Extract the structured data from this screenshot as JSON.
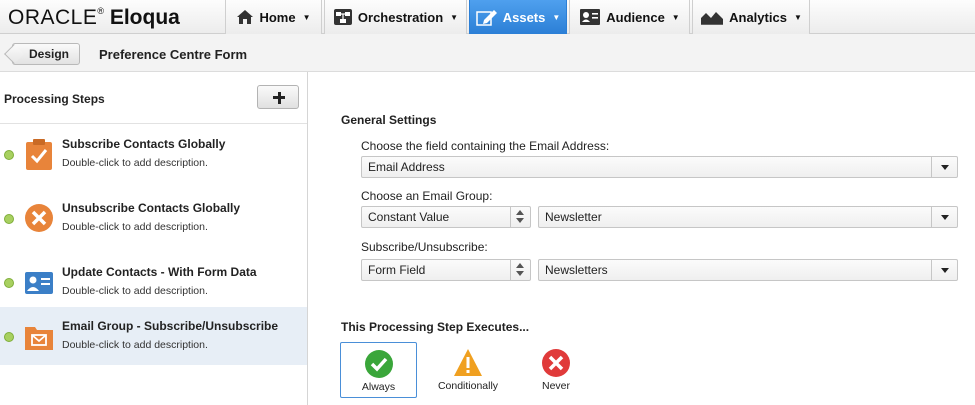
{
  "brand": {
    "oracle": "ORACLE",
    "product": "Eloqua"
  },
  "nav": {
    "items": [
      {
        "label": "Home",
        "icon": "house-icon"
      },
      {
        "label": "Orchestration",
        "icon": "orchestration-icon"
      },
      {
        "label": "Assets",
        "icon": "pencil-icon",
        "active": true
      },
      {
        "label": "Audience",
        "icon": "contact-card-icon"
      },
      {
        "label": "Analytics",
        "icon": "area-chart-icon"
      }
    ]
  },
  "breadcrumb": {
    "back_label": "Design",
    "title": "Preference Centre Form"
  },
  "steps_panel": {
    "title": "Processing Steps",
    "add_button": "+",
    "steps": [
      {
        "name": "Subscribe Contacts Globally",
        "description": "Double-click to add description.",
        "icon": "clipboard-check-icon",
        "color": "#e8843a"
      },
      {
        "name": "Unsubscribe Contacts Globally",
        "description": "Double-click to add description.",
        "icon": "circle-x-icon",
        "color": "#e8843a"
      },
      {
        "name": "Update Contacts - With Form Data",
        "description": "Double-click to add description.",
        "icon": "contact-card-icon",
        "color": "#3b7fc7"
      },
      {
        "name": "Email Group - Subscribe/Unsubscribe",
        "description": "Double-click to add description.",
        "icon": "email-folder-icon",
        "color": "#e8843a",
        "selected": true
      }
    ]
  },
  "general_settings": {
    "title": "General Settings",
    "email_field_label": "Choose the field containing the Email Address:",
    "email_field_value": "Email Address",
    "email_group_label": "Choose an Email Group:",
    "email_group_source": "Constant Value",
    "email_group_value": "Newsletter",
    "subscribe_label": "Subscribe/Unsubscribe:",
    "subscribe_source": "Form Field",
    "subscribe_value": "Newsletters"
  },
  "execution": {
    "title": "This Processing Step Executes...",
    "options": [
      {
        "label": "Always",
        "icon": "check-circle-icon",
        "color": "#3aa63a",
        "selected": true
      },
      {
        "label": "Conditionally",
        "icon": "warning-triangle-icon",
        "color": "#f0a020"
      },
      {
        "label": "Never",
        "icon": "x-circle-icon",
        "color": "#e03a3a"
      }
    ]
  }
}
